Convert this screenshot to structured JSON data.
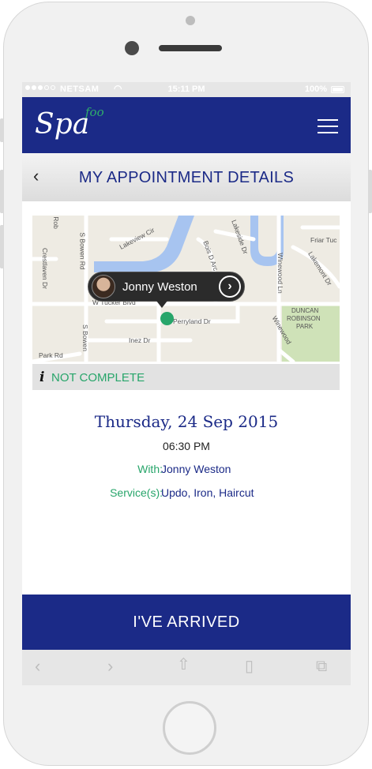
{
  "statusbar": {
    "carrier": "NETSAM",
    "time": "15:11 PM",
    "battery": "100%"
  },
  "brand": {
    "name_main": "Spa",
    "name_sub": "foo"
  },
  "header": {
    "title": "MY APPOINTMENT DETAILS"
  },
  "map": {
    "streets": [
      "Rob",
      "S Bowen Rd",
      "Lakeview Cir",
      "Bois D Arc",
      "Lakeside Dr",
      "Friar Tuc",
      "Lakemont Dr",
      "Crestlaven Dr",
      "Winewood Ln",
      "W Tucker Blvd",
      "Perryland Dr",
      "Inez Dr",
      "S Bowen",
      "Park Rd",
      "Winewood"
    ],
    "park_lines": [
      "DUNCAN",
      "ROBINSON",
      "PARK"
    ],
    "pin_name": "Jonny Weston"
  },
  "appointment": {
    "status": "NOT COMPLETE",
    "date": "Thursday, 24 Sep 2015",
    "time": "06:30 PM",
    "with_label": "With:",
    "with_value": "Jonny Weston",
    "services_label": "Service(s):",
    "services_value": "Updo, Iron, Haircut"
  },
  "actions": {
    "arrived": "I'VE ARRIVED"
  },
  "colors": {
    "brand_blue": "#1b2a87",
    "accent_green": "#27a56a"
  }
}
